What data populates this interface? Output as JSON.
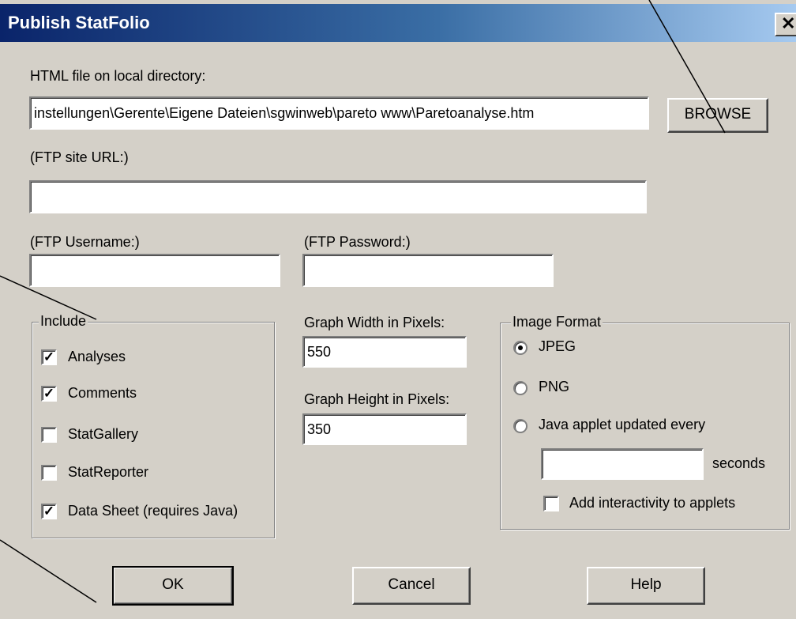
{
  "window": {
    "title": "Publish StatFolio",
    "close_glyph": "✕"
  },
  "html_file": {
    "label": "HTML file on local directory:",
    "value": "instellungen\\Gerente\\Eigene Dateien\\sgwinweb\\pareto www\\Paretoanalyse.htm",
    "browse_label": "BROWSE"
  },
  "ftp": {
    "url_label": "(FTP site URL:)",
    "url_value": "",
    "username_label": "(FTP Username:)",
    "username_value": "",
    "password_label": "(FTP Password:)",
    "password_value": ""
  },
  "include": {
    "legend": "Include",
    "items": [
      {
        "label": "Analyses",
        "checked": true
      },
      {
        "label": "Comments",
        "checked": true
      },
      {
        "label": "StatGallery",
        "checked": false
      },
      {
        "label": "StatReporter",
        "checked": false
      },
      {
        "label": "Data Sheet (requires Java)",
        "checked": true
      }
    ]
  },
  "graph": {
    "width_label": "Graph Width in Pixels:",
    "width_value": "550",
    "height_label": "Graph Height in Pixels:",
    "height_value": "350"
  },
  "image_format": {
    "legend": "Image Format",
    "options": [
      {
        "label": "JPEG",
        "selected": true
      },
      {
        "label": "PNG",
        "selected": false
      },
      {
        "label": "Java applet updated every",
        "selected": false
      }
    ],
    "seconds_value": "",
    "seconds_label": "seconds",
    "interactivity_label": "Add interactivity to applets",
    "interactivity_checked": false
  },
  "buttons": {
    "ok": "OK",
    "cancel": "Cancel",
    "help": "Help"
  },
  "colors": {
    "face": "#d4d0c8",
    "title_start": "#0a246a",
    "title_end": "#a6caf0"
  }
}
